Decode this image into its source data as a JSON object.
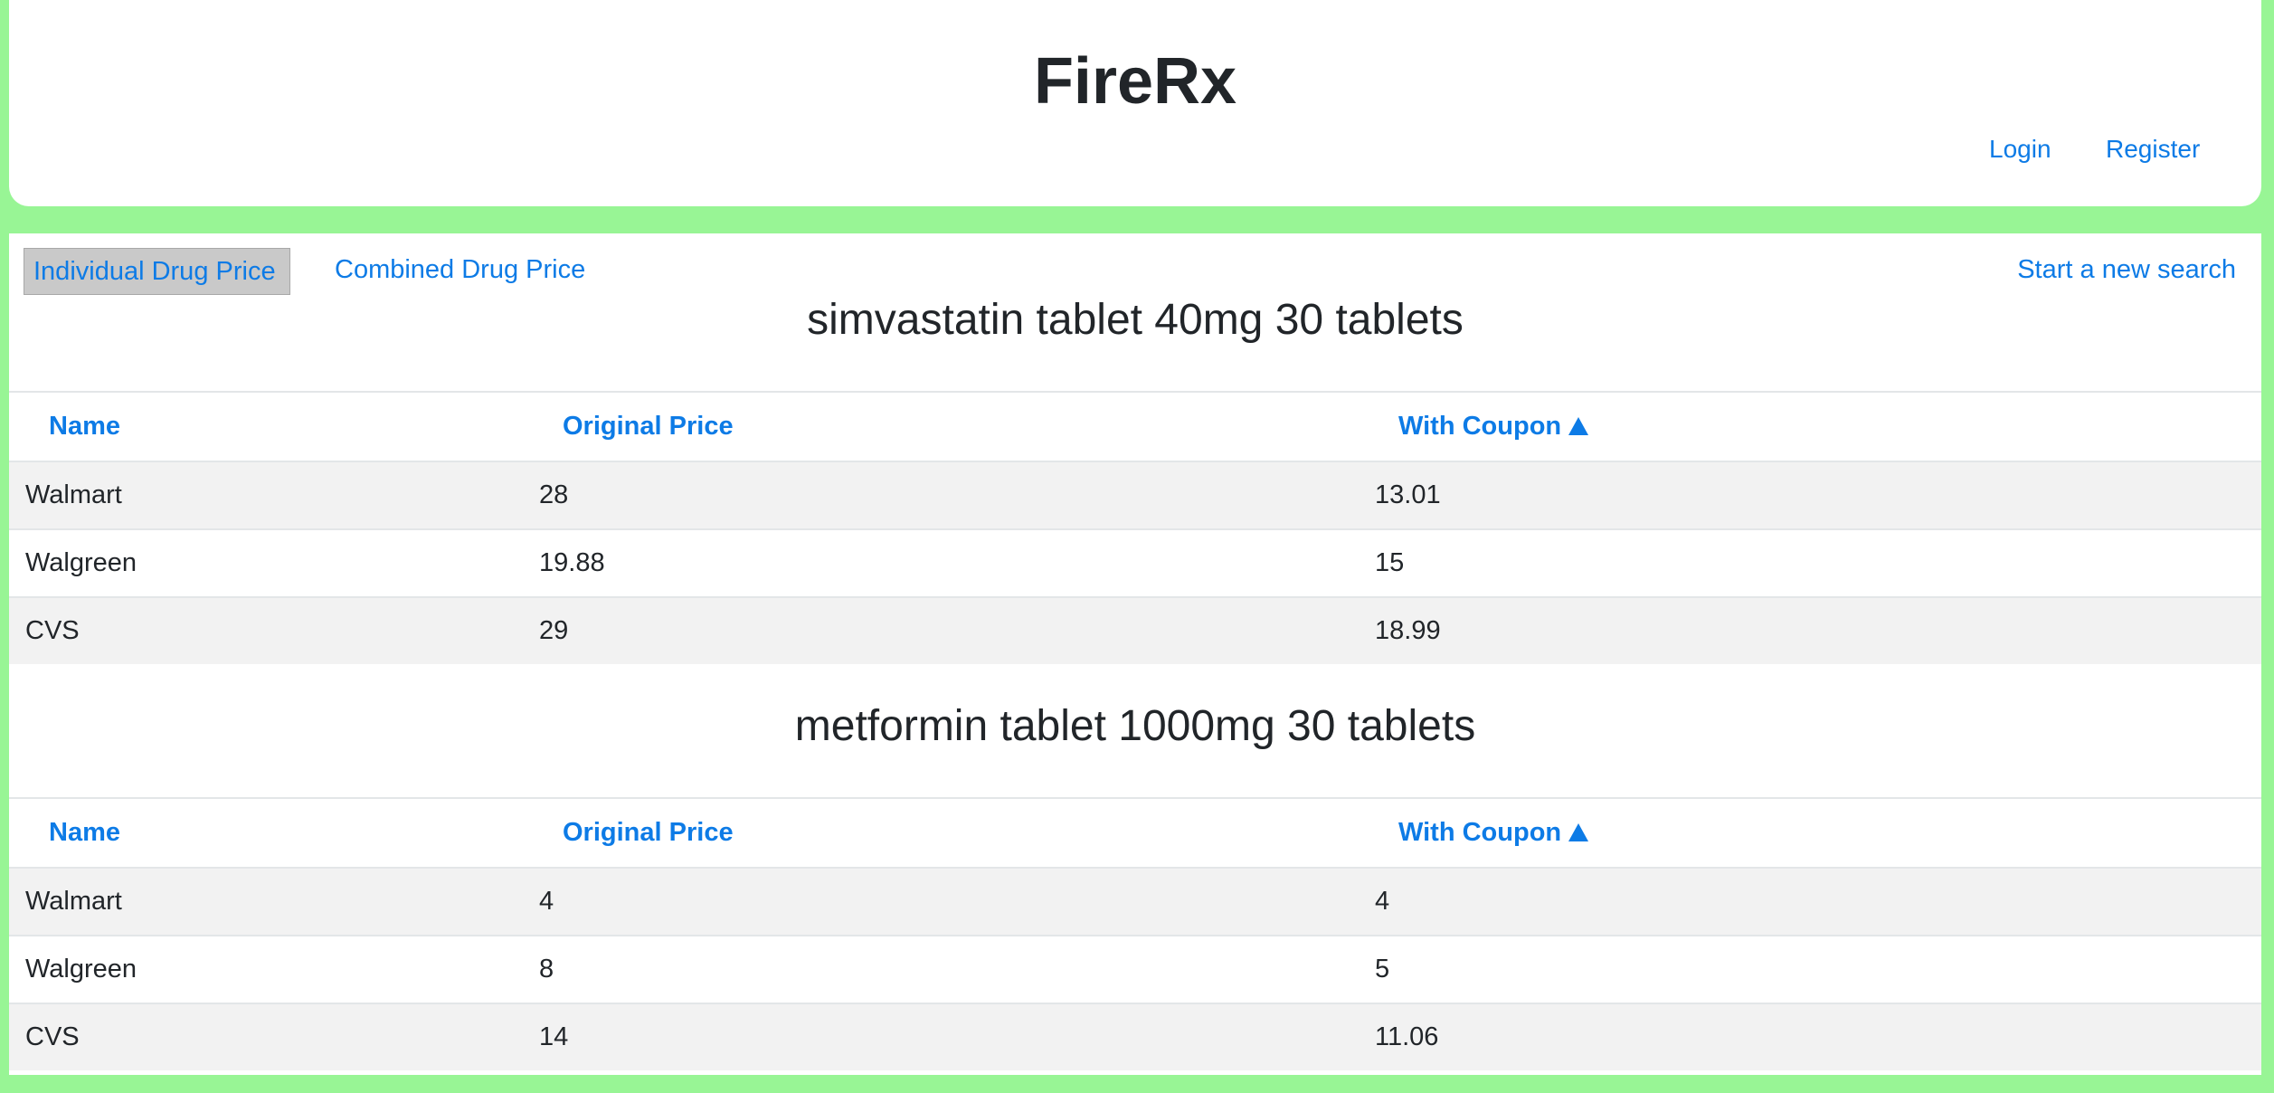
{
  "header": {
    "title": "FireRx",
    "login_label": "Login",
    "register_label": "Register"
  },
  "nav": {
    "tab_individual": "Individual Drug Price",
    "tab_combined": "Combined Drug Price",
    "new_search": "Start a new search"
  },
  "tables": [
    {
      "drug": "simvastatin tablet 40mg 30 tablets",
      "columns": [
        "Name",
        "Original Price",
        "With Coupon"
      ],
      "sort_icon": "sort-ascending-icon",
      "rows": [
        {
          "name": "Walmart",
          "original": "28",
          "coupon": "13.01"
        },
        {
          "name": "Walgreen",
          "original": "19.88",
          "coupon": "15"
        },
        {
          "name": "CVS",
          "original": "29",
          "coupon": "18.99"
        }
      ]
    },
    {
      "drug": "metformin tablet 1000mg 30 tablets",
      "columns": [
        "Name",
        "Original Price",
        "With Coupon"
      ],
      "sort_icon": "sort-ascending-icon",
      "rows": [
        {
          "name": "Walmart",
          "original": "4",
          "coupon": "4"
        },
        {
          "name": "Walgreen",
          "original": "8",
          "coupon": "5"
        },
        {
          "name": "CVS",
          "original": "14",
          "coupon": "11.06"
        }
      ]
    }
  ],
  "colors": {
    "background": "#98f595",
    "link": "#0d7be6",
    "active_tab_bg": "#c9c9c9",
    "stripe": "#f2f2f2"
  }
}
